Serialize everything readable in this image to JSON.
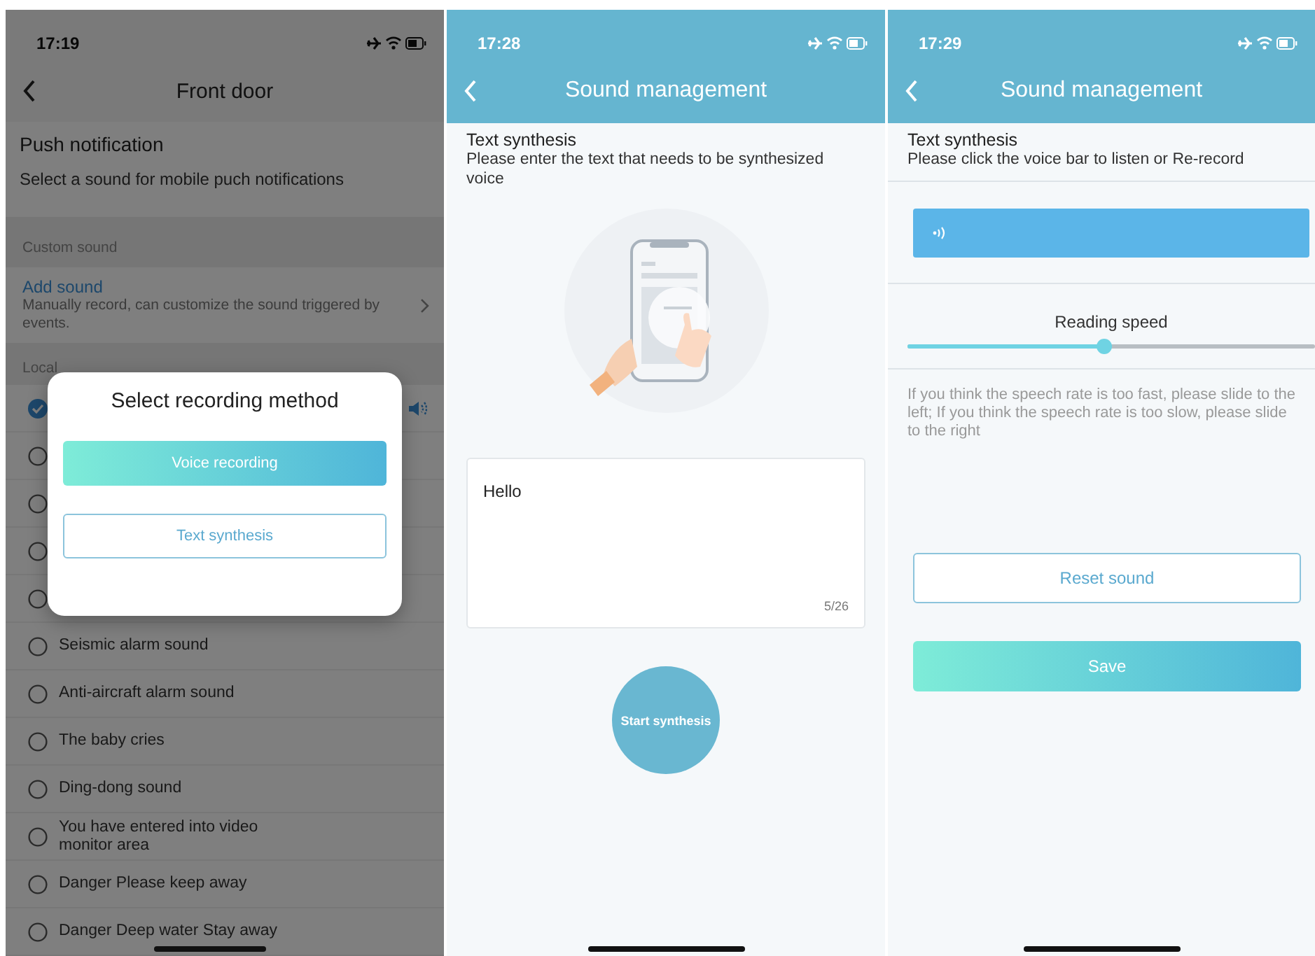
{
  "front_door": {
    "time": "17:19",
    "title": "Front door",
    "heading": "Push notification",
    "subheading": "Select a sound for mobile puch notifications",
    "custom_section": "Custom sound",
    "add_sound": {
      "title": "Add sound",
      "description": "Manually record, can customize the sound triggered by events."
    },
    "local_section": "Local",
    "sounds": [
      {
        "selected": true
      },
      {
        "selected": false
      },
      {
        "selected": false
      },
      {
        "selected": false
      },
      {
        "selected": false
      },
      {
        "label": "Seismic alarm sound",
        "selected": false
      },
      {
        "label": "Anti-aircraft alarm sound",
        "selected": false
      },
      {
        "label": "The baby cries",
        "selected": false
      },
      {
        "label": "Ding-dong sound",
        "selected": false
      },
      {
        "label": "You have entered into video monitor area",
        "selected": false
      },
      {
        "label": "Danger Please keep away",
        "selected": false
      },
      {
        "label": "Danger Deep water Stay away",
        "selected": false
      }
    ],
    "dialog": {
      "title": "Select recording method",
      "buttons": [
        {
          "label": "Voice recording",
          "kind": "primary"
        },
        {
          "label": "Text synthesis",
          "kind": "outline"
        }
      ]
    }
  },
  "synthesis_input": {
    "time": "17:28",
    "title": "Sound management",
    "heading": "Text synthesis",
    "subheading": "Please enter the text that needs to be synthesized voice",
    "text": "Hello",
    "counter": "5/26",
    "button": "Start synthesis"
  },
  "synthesis_result": {
    "time": "17:29",
    "title": "Sound management",
    "heading": "Text synthesis",
    "subheading": "Please click the voice bar to listen or Re-record",
    "speed_label": "Reading speed",
    "speed": {
      "level": 0.48
    },
    "hint": "If you think the speech rate is too fast, please slide to the left; If you think the speech rate is too slow, please slide to the right",
    "buttons": [
      {
        "label": "Reset sound",
        "kind": "outline"
      },
      {
        "label": "Save",
        "kind": "primary"
      }
    ]
  }
}
